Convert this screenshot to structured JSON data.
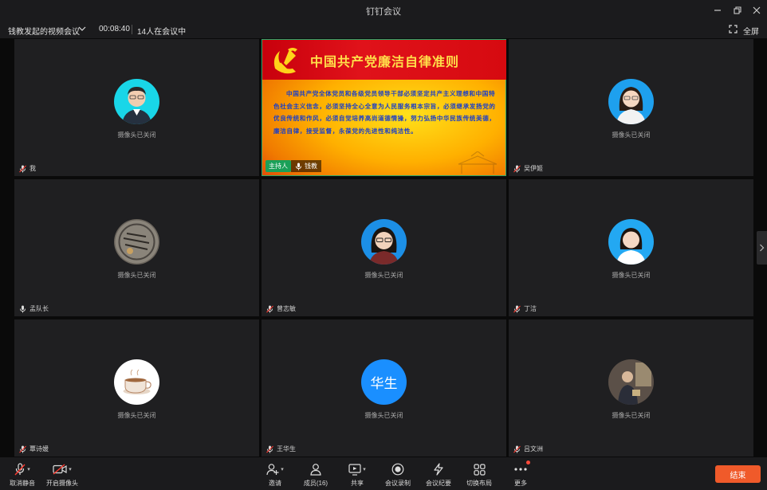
{
  "window": {
    "title": "钉钉会议"
  },
  "infobar": {
    "meeting_name": "钱教发起的视频会议",
    "timer": "00:08:40",
    "participants_in_meeting": "14人在会议中",
    "fullscreen_label": "全屏"
  },
  "presentation": {
    "title": "中国共产党廉洁自律准则",
    "body": "中国共产党全体党员和各级党员领导干部必须坚定共产主义理想和中国特色社会主义信念，必须坚持全心全意为人民服务根本宗旨，必须继承发扬党的优良传统和作风，必须自觉培养高尚道德情操，努力弘扬中华民族传统美德，廉洁自律，接受监督，永葆党的先进性和纯洁性。",
    "host_tag": "主持人",
    "host_name": "钱教"
  },
  "tiles": [
    {
      "name": "我",
      "status": "摄像头已关闭"
    },
    {
      "name": "吴伊姬",
      "status": "摄像头已关闭"
    },
    {
      "name": "孟队长",
      "status": "摄像头已关闭"
    },
    {
      "name": "曾志敏",
      "status": "摄像头已关闭"
    },
    {
      "name": "丁洁",
      "status": "摄像头已关闭"
    },
    {
      "name": "覃诗媛",
      "status": "摄像头已关闭"
    },
    {
      "name": "王华生",
      "status": "摄像头已关闭",
      "avatar_text": "华生"
    },
    {
      "name": "吕文洲",
      "status": "摄像头已关闭"
    }
  ],
  "toolbar": {
    "unmute": "取消静音",
    "start_video": "开启摄像头",
    "invite": "邀请",
    "members": "成员(16)",
    "share": "共享",
    "record": "会议录制",
    "minutes": "会议纪要",
    "layout": "切换布局",
    "more": "更多",
    "end": "结束"
  },
  "colors": {
    "end_button": "#f05a2a",
    "host_tag": "#1aa058",
    "avatar_blue": "#1a8fff"
  }
}
